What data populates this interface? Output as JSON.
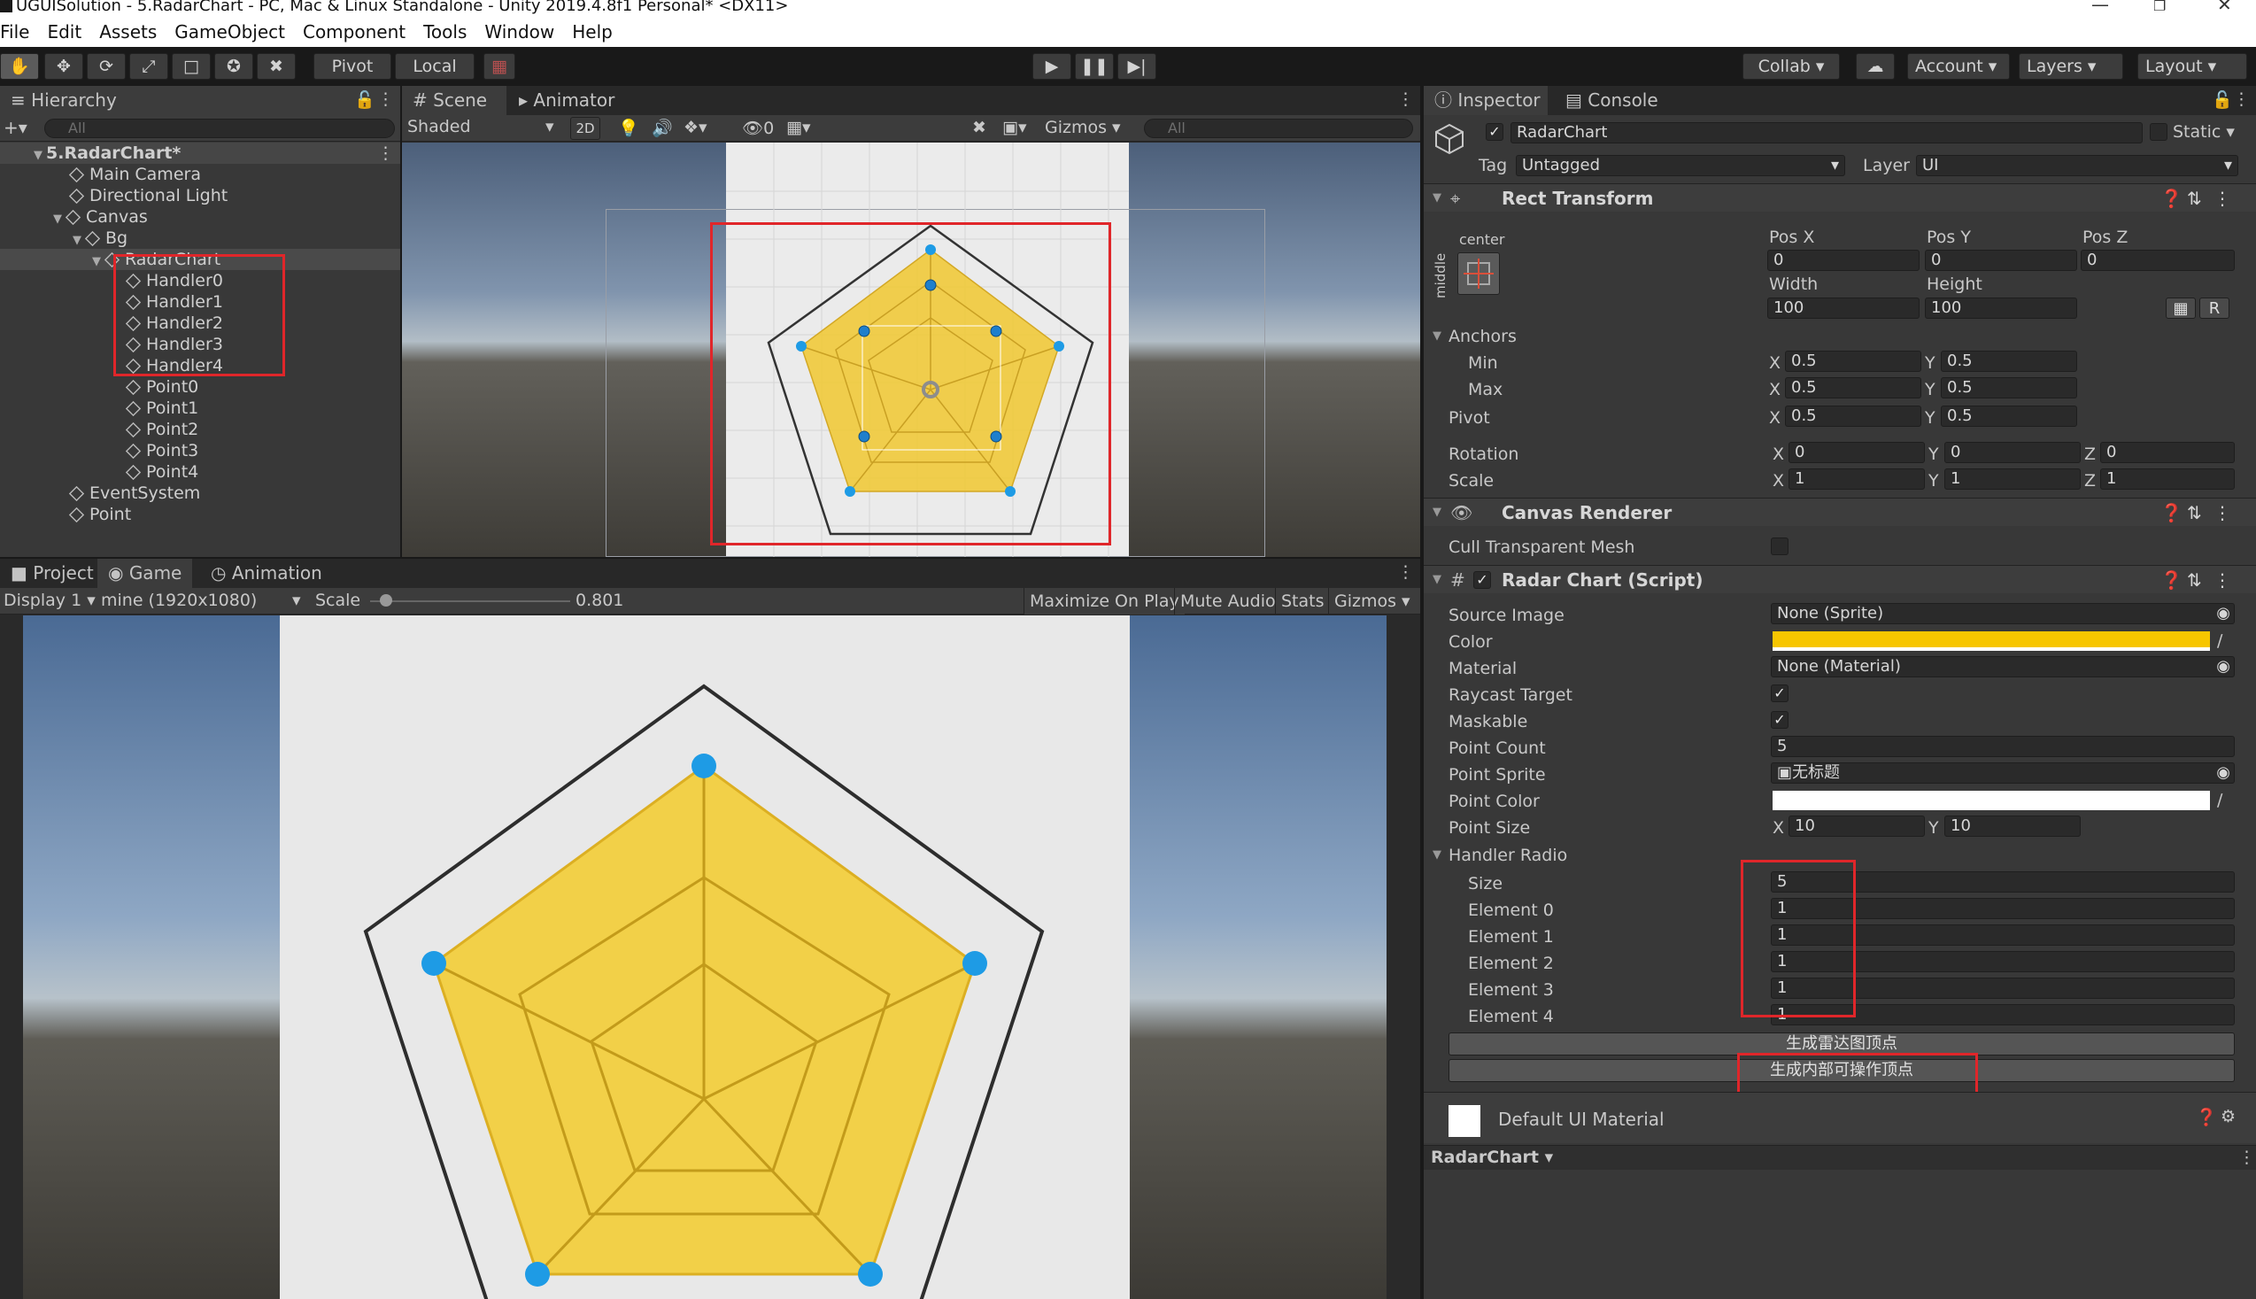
{
  "window": {
    "title": "UGUISolution - 5.RadarChart - PC, Mac & Linux Standalone - Unity 2019.4.8f1 Personal* <DX11>"
  },
  "menu": [
    "File",
    "Edit",
    "Assets",
    "GameObject",
    "Component",
    "Tools",
    "Window",
    "Help"
  ],
  "toolbar": {
    "pivot": "Pivot",
    "local": "Local",
    "collab": "Collab ▾",
    "account": "Account",
    "layers": "Layers",
    "layout": "Layout"
  },
  "hierarchy": {
    "tab": "Hierarchy",
    "search_placeholder": "All",
    "scene_name": "5.RadarChart*",
    "items": [
      {
        "name": "Main Camera"
      },
      {
        "name": "Directional Light"
      },
      {
        "name": "Canvas"
      },
      {
        "name": "Bg"
      },
      {
        "name": "RadarChart"
      },
      {
        "name": "Handler0"
      },
      {
        "name": "Handler1"
      },
      {
        "name": "Handler2"
      },
      {
        "name": "Handler3"
      },
      {
        "name": "Handler4"
      },
      {
        "name": "Point0"
      },
      {
        "name": "Point1"
      },
      {
        "name": "Point2"
      },
      {
        "name": "Point3"
      },
      {
        "name": "Point4"
      },
      {
        "name": "EventSystem"
      },
      {
        "name": "Point"
      }
    ]
  },
  "scene": {
    "tabs": [
      "Scene",
      "Animator"
    ],
    "shading": "Shaded",
    "mode_2d": "2D",
    "hidden_count": "0",
    "gizmos": "Gizmos",
    "search_placeholder": "All"
  },
  "game": {
    "tabs": [
      "Project",
      "Game",
      "Animation"
    ],
    "display": "Display 1",
    "resolution": "mine (1920x1080)",
    "scale_label": "Scale",
    "scale_value": "0.801",
    "scale_fraction": 0.08,
    "buttons": [
      "Maximize On Play",
      "Mute Audio",
      "Stats",
      "Gizmos"
    ]
  },
  "inspector": {
    "tabs": [
      "Inspector",
      "Console"
    ],
    "object_name": "RadarChart",
    "static_label": "Static",
    "tag_label": "Tag",
    "tag_value": "Untagged",
    "layer_label": "Layer",
    "layer_value": "UI",
    "rect_transform": {
      "title": "Rect Transform",
      "anchor_h": "center",
      "anchor_v": "middle",
      "pos_x_label": "Pos X",
      "pos_y_label": "Pos Y",
      "pos_z_label": "Pos Z",
      "pos_x": "0",
      "pos_y": "0",
      "pos_z": "0",
      "width_label": "Width",
      "height_label": "Height",
      "width": "100",
      "height": "100",
      "r_button": "R",
      "anchors_label": "Anchors",
      "min_label": "Min",
      "max_label": "Max",
      "pivot_label": "Pivot",
      "min_x": "0.5",
      "min_y": "0.5",
      "max_x": "0.5",
      "max_y": "0.5",
      "pivot_x": "0.5",
      "pivot_y": "0.5",
      "rotation_label": "Rotation",
      "scale_label": "Scale",
      "rot_x": "0",
      "rot_y": "0",
      "rot_z": "0",
      "scale_x": "1",
      "scale_y": "1",
      "scale_z": "1",
      "x_letter": "X",
      "y_letter": "Y",
      "z_letter": "Z"
    },
    "canvas_renderer": {
      "title": "Canvas Renderer",
      "cull_label": "Cull Transparent Mesh"
    },
    "radar_chart": {
      "title": "Radar Chart (Script)",
      "source_image_label": "Source Image",
      "source_image": "None (Sprite)",
      "color_label": "Color",
      "color": "#f7c600",
      "material_label": "Material",
      "material": "None (Material)",
      "raycast_label": "Raycast Target",
      "maskable_label": "Maskable",
      "point_count_label": "Point Count",
      "point_count": "5",
      "point_sprite_label": "Point Sprite",
      "point_sprite": "无标题",
      "point_color_label": "Point Color",
      "point_color": "#ffffff",
      "point_size_label": "Point Size",
      "point_size_x": "10",
      "point_size_y": "10",
      "handler_radio_label": "Handler Radio",
      "size_label": "Size",
      "size": "5",
      "elements": [
        {
          "label": "Element 0",
          "value": "1"
        },
        {
          "label": "Element 1",
          "value": "1"
        },
        {
          "label": "Element 2",
          "value": "1"
        },
        {
          "label": "Element 3",
          "value": "1"
        },
        {
          "label": "Element 4",
          "value": "1"
        }
      ],
      "button_generate_vertices": "生成雷达图顶点",
      "button_generate_handlers": "生成内部可操作顶点"
    },
    "material_footer": "Default UI Material",
    "preview_label": "RadarChart ▾"
  }
}
